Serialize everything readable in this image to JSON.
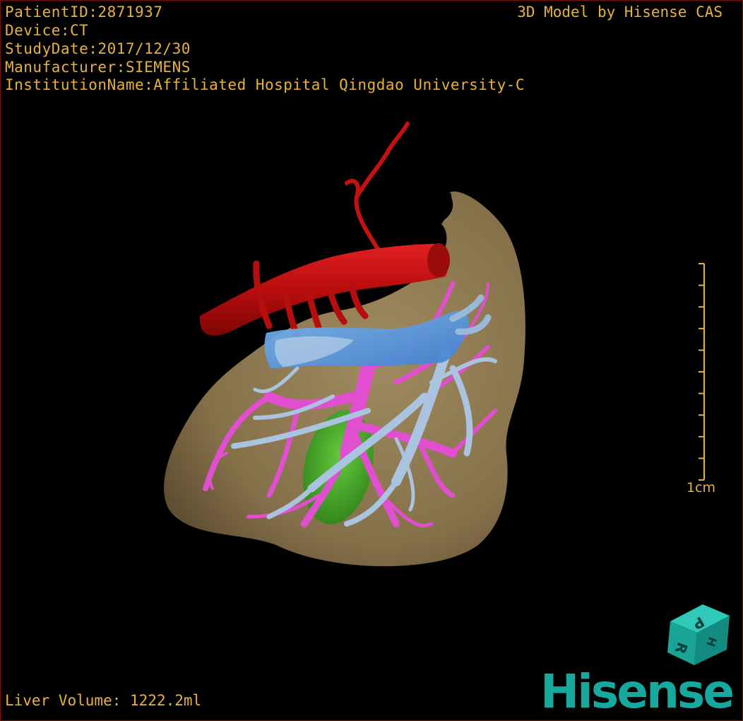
{
  "header": {
    "patient_id": "PatientID:2871937",
    "device": "Device:CT",
    "study_date": "StudyDate:2017/12/30",
    "manufacturer": "Manufacturer:SIEMENS",
    "institution": "InstitutionName:Affiliated Hospital Qingdao University-C"
  },
  "credit": "3D Model by Hisense CAS",
  "scale": {
    "label": "1cm",
    "ticks": 10
  },
  "orientation_cube": {
    "faces": [
      "P",
      "R",
      "H"
    ]
  },
  "footer": {
    "volume": "Liver Volume: 1222.2ml"
  },
  "brand": {
    "name": "Hisense"
  },
  "colors": {
    "text": "#e8b23a",
    "liver": "#8d7550",
    "artery": "#c41212",
    "portal_vein": "#e14fd0",
    "hepatic_vein": "#aac4e0",
    "ivc": "#5a9fe8",
    "gallbladder": "#3db82a",
    "brand": "#17a99e"
  },
  "structures": [
    "liver",
    "hepatic-artery",
    "aorta",
    "portal-vein",
    "hepatic-vein",
    "inferior-vena-cava",
    "gallbladder"
  ]
}
